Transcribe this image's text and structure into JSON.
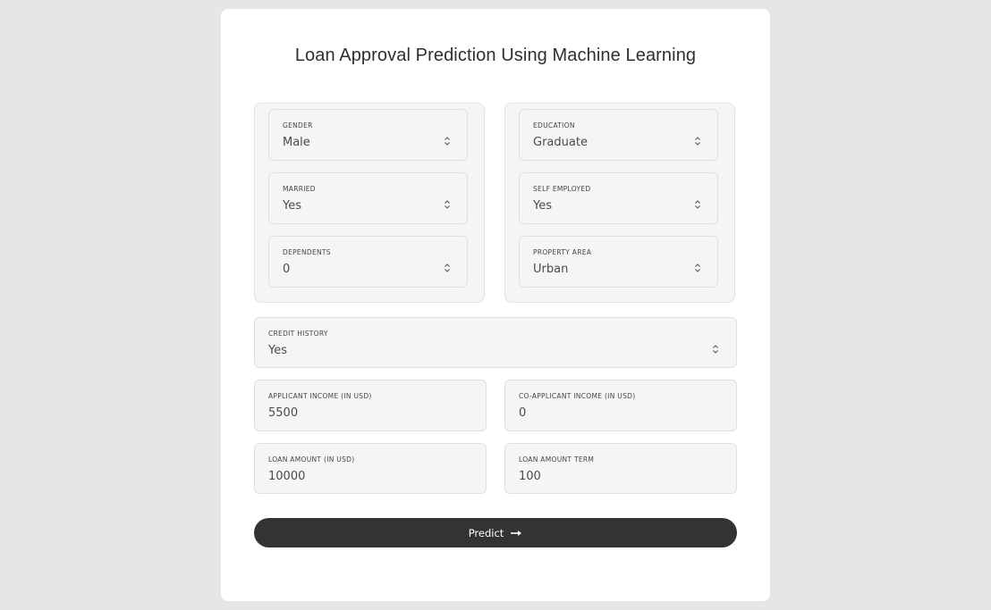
{
  "page": {
    "title": "Loan Approval Prediction Using Machine Learning"
  },
  "form": {
    "gender": {
      "label": "GENDER",
      "value": "Male"
    },
    "married": {
      "label": "MARRIED",
      "value": "Yes"
    },
    "dependents": {
      "label": "DEPENDENTS",
      "value": "0"
    },
    "education": {
      "label": "EDUCATION",
      "value": "Graduate"
    },
    "self_employed": {
      "label": "SELF EMPLOYED",
      "value": "Yes"
    },
    "property_area": {
      "label": "PROPERTY AREA",
      "value": "Urban"
    },
    "credit_history": {
      "label": "CREDIT HISTORY",
      "value": "Yes"
    },
    "applicant_income": {
      "label": "APPLICANT INCOME (IN USD)",
      "value": "5500"
    },
    "coapplicant_income": {
      "label": "CO-APPLICANT INCOME (IN USD)",
      "value": "0"
    },
    "loan_amount": {
      "label": "LOAN AMOUNT (IN USD)",
      "value": "10000"
    },
    "loan_amount_term": {
      "label": "LOAN AMOUNT TERM",
      "value": "100"
    }
  },
  "predict_button": {
    "label": "Predict",
    "icon": "arrow-right-icon"
  },
  "colors": {
    "background": "#e6e6e6",
    "card": "#ffffff",
    "field": "#f5f5f5",
    "button": "#333333"
  }
}
